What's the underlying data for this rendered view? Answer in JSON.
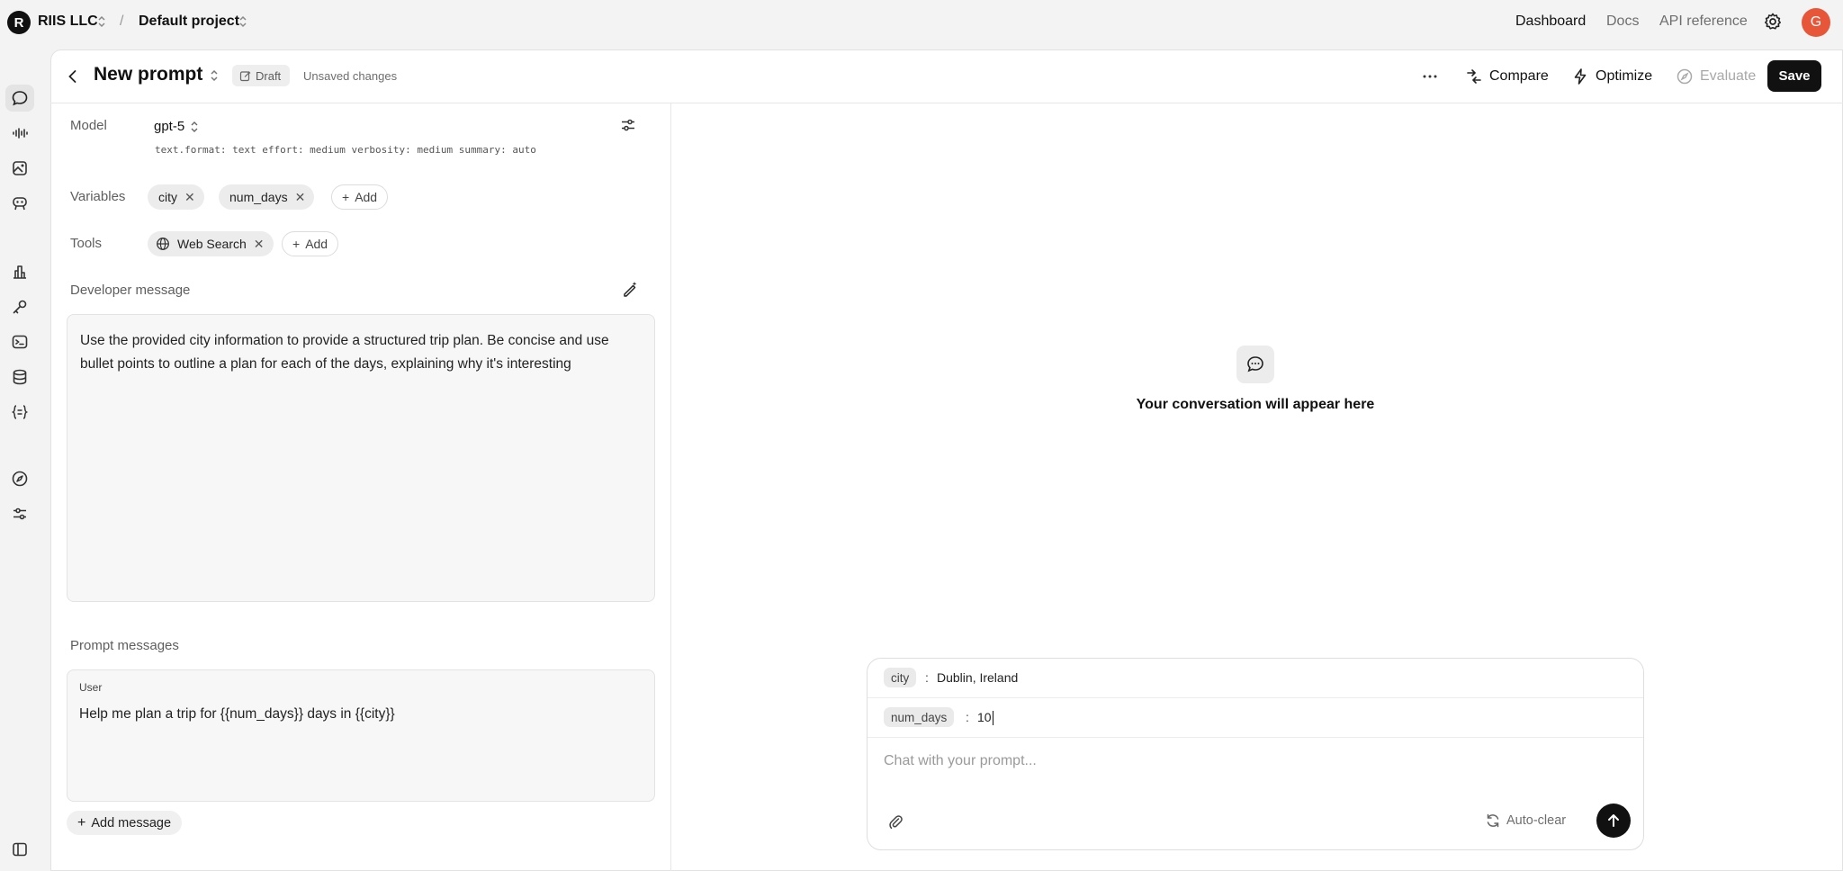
{
  "topbar": {
    "org_initial": "R",
    "org_name": "RIIS LLC",
    "separator": "/",
    "project": "Default project",
    "nav": [
      "Dashboard",
      "Docs",
      "API reference"
    ],
    "user_initial": "G"
  },
  "header": {
    "title": "New prompt",
    "status_badge": "Draft",
    "unsaved": "Unsaved changes",
    "compare": "Compare",
    "optimize": "Optimize",
    "evaluate": "Evaluate",
    "save": "Save"
  },
  "config": {
    "model_label": "Model",
    "model_name": "gpt-5",
    "model_params": "text.format: text effort: medium verbosity: medium summary: auto",
    "variables_label": "Variables",
    "variables": [
      "city",
      "num_days"
    ],
    "tools_label": "Tools",
    "tools": [
      "Web Search"
    ],
    "add_label": "Add",
    "developer_label": "Developer message",
    "developer_message": "Use the provided city information to provide a structured trip plan. Be concise and use bullet points to outline a plan for each of the days, explaining why it's interesting",
    "prompt_messages_label": "Prompt messages",
    "user_role": "User",
    "user_message": "Help me plan a trip for {{num_days}} days in {{city}}",
    "add_message": "Add message"
  },
  "chat": {
    "empty_text": "Your conversation will appear here",
    "var_values": [
      {
        "name": "city",
        "value": "Dublin, Ireland"
      },
      {
        "name": "num_days",
        "value": "10"
      }
    ],
    "colon": ":",
    "placeholder": "Chat with your prompt...",
    "autoclear": "Auto-clear"
  },
  "icons": {
    "rail": [
      "chat-icon",
      "audio-icon",
      "image-icon",
      "assistants-icon",
      "usage-icon",
      "key-icon",
      "terminal-icon",
      "storage-icon",
      "variables-icon",
      "compass-icon",
      "settings-sliders-icon",
      "sidebar-toggle-icon"
    ]
  }
}
